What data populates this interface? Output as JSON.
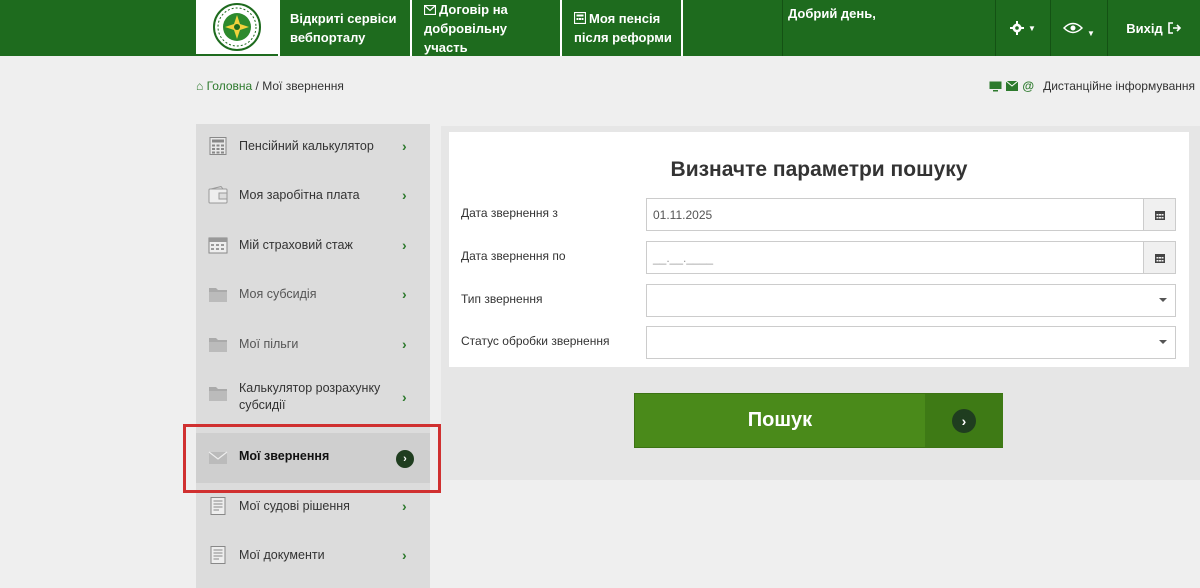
{
  "header": {
    "portal_title": "Відкриті сервіси вебпорталу",
    "contract_label": "Договір на добровільну участь",
    "pension_label": "Моя пенсія після реформи",
    "greeting": "Добрий день,",
    "logout_label": "Вихід"
  },
  "breadcrumb": {
    "home": "Головна",
    "separator": "/",
    "current": "Мої звернення"
  },
  "remote_info": "Дистанційне інформування",
  "sidebar": {
    "items": [
      {
        "label": "Пенсійний калькулятор",
        "icon": "calculator-icon"
      },
      {
        "label": "Моя заробітна плата",
        "icon": "wallet-icon"
      },
      {
        "label": "Мій страховий стаж",
        "icon": "calendar-icon"
      },
      {
        "label": "Моя субсидія",
        "icon": "folder-icon"
      },
      {
        "label": "Мої пільги",
        "icon": "folder-icon"
      },
      {
        "label": "Калькулятор розрахунку субсидії",
        "icon": "folder-icon"
      },
      {
        "label": "Мої звернення",
        "icon": "envelope-icon"
      },
      {
        "label": "Мої судові рішення",
        "icon": "document-icon"
      },
      {
        "label": "Мої документи",
        "icon": "document-icon"
      }
    ],
    "active_index": 6
  },
  "search_form": {
    "title": "Визначте параметри пошуку",
    "date_from_label": "Дата звернення з",
    "date_from_value": "01.11.2025",
    "date_to_label": "Дата звернення по",
    "date_to_placeholder": "__.__.____",
    "type_label": "Тип звернення",
    "type_value": "",
    "status_label": "Статус обробки звернення",
    "status_value": "",
    "search_button": "Пошук"
  },
  "colors": {
    "header_green": "#1e6b1e",
    "button_green": "#4a8a1a",
    "highlight_red": "#d03030"
  }
}
